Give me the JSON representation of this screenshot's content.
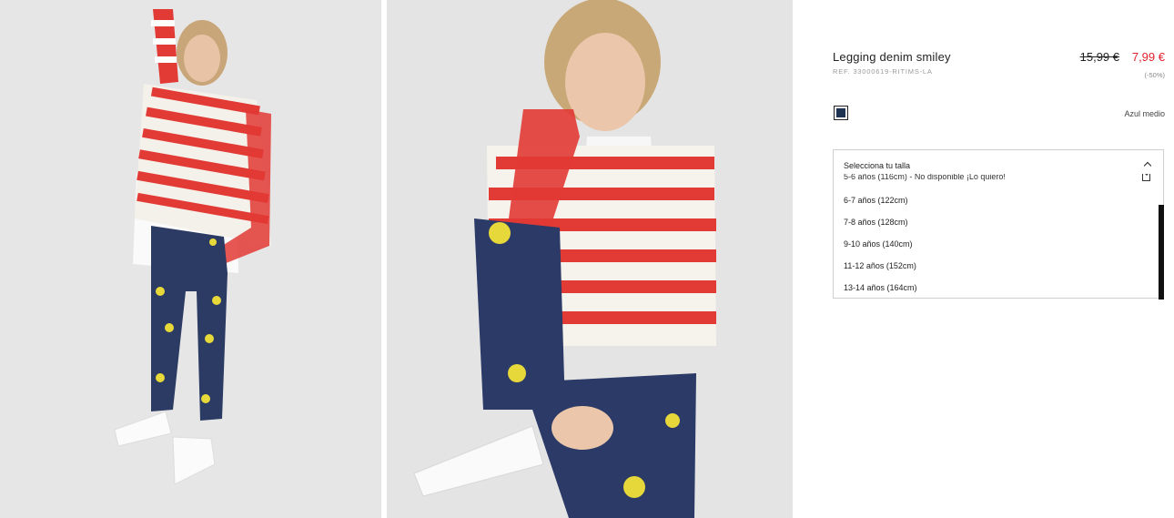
{
  "product": {
    "title": "Legging denim smiley",
    "ref": "REF. 33000619-RITIMS-LA",
    "price_old": "15,99 €",
    "price_new": "7,99 €",
    "discount": "(-50%)",
    "sale_color": "#e4202f"
  },
  "color": {
    "name": "Azul medio",
    "swatch_hex": "#1e3352"
  },
  "size_select": {
    "label": "Selecciona tu talla",
    "options": [
      "5-6 años (116cm) - No disponible ¡Lo quiero!",
      "6-7 años (122cm)",
      "7-8 años (128cm)",
      "9-10 años (140cm)",
      "11-12 años (152cm)",
      "13-14 años (164cm)"
    ],
    "icons": {
      "toggle": "chevron-up-icon",
      "notify": "notify-icon"
    }
  }
}
